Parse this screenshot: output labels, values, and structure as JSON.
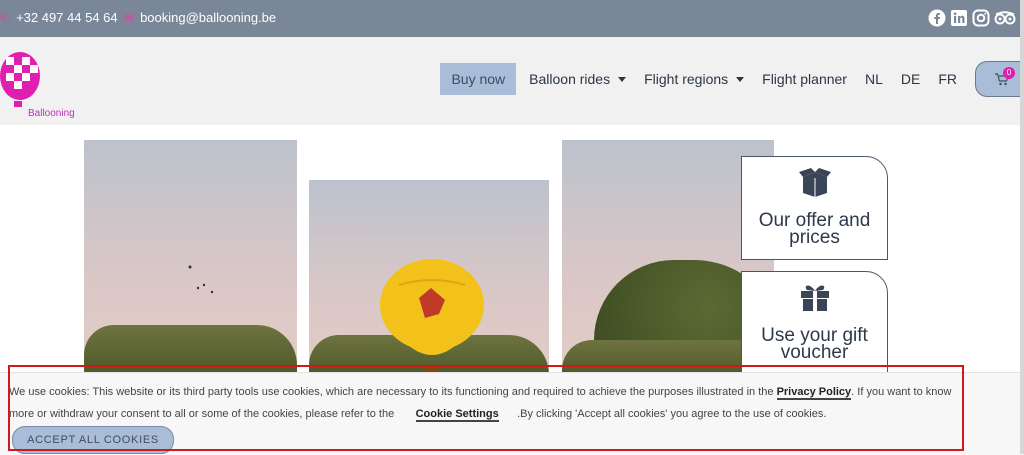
{
  "topbar": {
    "phone": "+32 497 44 54 64",
    "email": "booking@ballooning.be",
    "social_icons": [
      "facebook-icon",
      "linkedin-icon",
      "instagram-icon",
      "tripadvisor-icon"
    ]
  },
  "header": {
    "logo_text": "Ballooning",
    "nav": {
      "buy_now": "Buy now",
      "balloon_rides": "Balloon rides",
      "flight_regions": "Flight regions",
      "flight_planner": "Flight planner",
      "lang_nl": "NL",
      "lang_de": "DE",
      "lang_fr": "FR"
    },
    "cart_count": "0"
  },
  "cards": {
    "offer": "Our offer and prices",
    "voucher": "Use your gift voucher"
  },
  "cookie": {
    "text_1": "We use cookies: This website or its third party tools use cookies, which are necessary to its functioning and required to achieve the purposes illustrated in the",
    "privacy_link": "Privacy Policy",
    "text_2": ". If you want to know more or withdraw your consent to all or some of the cookies, please refer to the",
    "settings_link": "Cookie Settings",
    "text_3": ".By clicking 'Accept all cookies' you agree to the use of cookies.",
    "accept_button": "ACCEPT ALL COOKIES"
  },
  "colors": {
    "topbar": "#7a8799",
    "accent": "#a9bdd8",
    "brand_pink": "#e01eaf",
    "highlight": "#d01a1a"
  }
}
